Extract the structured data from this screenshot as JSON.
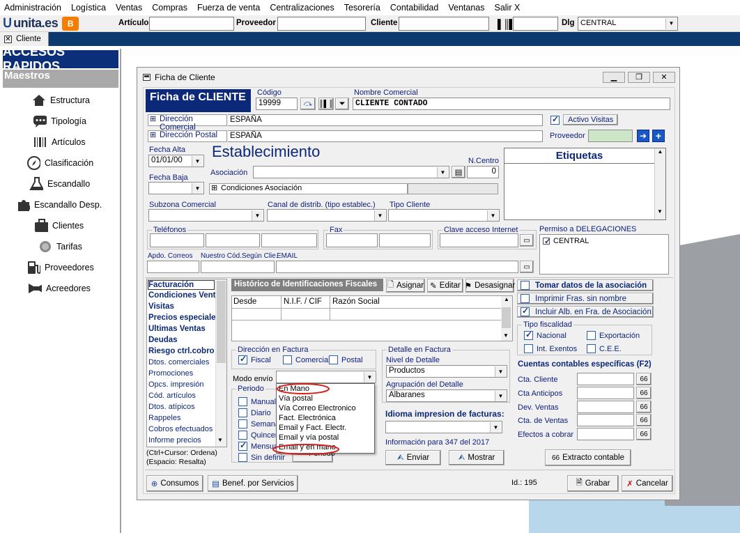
{
  "menu": [
    "Administración",
    "Logística",
    "Ventas",
    "Compras",
    "Fuerza de venta",
    "Centralizaciones",
    "Tesorería",
    "Contabilidad",
    "Ventanas",
    "Salir X"
  ],
  "toolbar": {
    "logo": "unita.es",
    "articulo_label": "Artículo",
    "proveedor_label": "Proveedor",
    "cliente_label": "Cliente",
    "dlg_label": "Dlg",
    "dlg_value": "CENTRAL"
  },
  "tab": {
    "label": "Cliente"
  },
  "left": {
    "header": "ACCESOS RAPIDOS",
    "section": "Maestros",
    "items": [
      {
        "label": "Estructura",
        "icon": "house-icon"
      },
      {
        "label": "Tipología",
        "icon": "speech-bubble-icon"
      },
      {
        "label": "Artículos",
        "icon": "barcode-icon"
      },
      {
        "label": "Clasificación",
        "icon": "compass-icon"
      },
      {
        "label": "Escandallo",
        "icon": "flask-icon"
      },
      {
        "label": "Escandallo Desp.",
        "icon": "puzzle-icon"
      },
      {
        "label": "Clientes",
        "icon": "briefcase-icon"
      },
      {
        "label": "Tarifas",
        "icon": "tag-icon"
      },
      {
        "label": "Proveedores",
        "icon": "fuel-icon"
      },
      {
        "label": "Acreedores",
        "icon": "bowtie-icon"
      }
    ]
  },
  "window": {
    "title": "Ficha de Cliente"
  },
  "form": {
    "header": "Ficha de CLIENTE",
    "codigo_label": "Código",
    "codigo": "19999",
    "nombre_label": "Nombre Comercial",
    "nombre": "CLIENTE CONTADO",
    "dir_comercial": "Dirección Comercial",
    "dir_comercial_val": "ESPAÑA",
    "dir_postal": "Dirección Postal",
    "dir_postal_val": "ESPAÑA",
    "activo_visitas": "Activo Visitas",
    "proveedor": "Proveedor",
    "fecha_alta_label": "Fecha Alta",
    "fecha_alta": "01/01/00",
    "fecha_baja_label": "Fecha Baja",
    "establecimiento": "Establecimiento",
    "asociacion_label": "Asociación",
    "ncentro_label": "N.Centro",
    "ncentro": "0",
    "condiciones": "Condiciones Asociación",
    "etiquetas": "Etiquetas",
    "subzona": "Subzona Comercial",
    "canal": "Canal de distrib. (tipo establec.)",
    "tipo_cliente": "Tipo Cliente",
    "telefonos": "Teléfonos",
    "fax": "Fax",
    "clave": "Clave acceso Internet",
    "permiso": "Permiso a DELEGACIONES",
    "central": "CENTRAL",
    "apdo": "Apdo. Correos",
    "nuestro": "Nuestro Cód.Según Clie.",
    "email": "EMAIL"
  },
  "nav": [
    "Facturación",
    "Condiciones Venta",
    "Visitas",
    "Precios especiales",
    "Ultimas Ventas",
    "Deudas",
    "Riesgo ctrl.cobro",
    "Dtos. comerciales",
    "Promociones",
    "Opcs. impresión",
    "Cód. artículos",
    "Dtos. atípicos",
    "Rappeles",
    "Cobros efectuados",
    "Informe precios"
  ],
  "nav_hint": [
    "(Ctrl+Cursor: Ordena)",
    "(Espacio: Resalta)"
  ],
  "historico": {
    "title": "Histórico de Identificaciones Fiscales",
    "asignar": "Asignar",
    "editar": "Editar",
    "desasignar": "Desasignar",
    "cols": [
      "Desde",
      "N.I.F. / CIF",
      "Razón Social"
    ]
  },
  "dir_factura": {
    "title": "Dirección en Factura",
    "fiscal": "Fiscal",
    "comercial": "Comercial",
    "postal": "Postal"
  },
  "modo_envio": "Modo envío",
  "periodo": {
    "title": "Periodo",
    "items": [
      "Manual",
      "Diario",
      "Semanal",
      "Quincenal",
      "Mensual",
      "Sin definir"
    ],
    "extra": "Periodo"
  },
  "popup": [
    "En Mano",
    "Vía postal",
    "Vía Correo Electronico",
    "Fact. Electrónica",
    "Email y Fact. Electr.",
    "Email y vía postal",
    "Email y en mano"
  ],
  "detalle": {
    "title": "Detalle en Factura",
    "nivel": "Nivel de Detalle",
    "nivel_val": "Productos",
    "agrup": "Agrupación del Detalle",
    "agrup_val": "Albaranes"
  },
  "idioma": "Idioma impresion de facturas:",
  "info347": "Información para 347 del 2017",
  "enviar": "Enviar",
  "mostrar": "Mostrar",
  "right": {
    "tomar": "Tomar datos de la asociación",
    "imprimir": "Imprimir Fras. sin nombre",
    "incluir": "Incluir Alb. en Fra. de Asociación",
    "tipo_fisc": "Tipo fiscalidad",
    "nacional": "Nacional",
    "exportacion": "Exportación",
    "exentos": "Int. Exentos",
    "cee": "C.E.E.",
    "cuentas": "Cuentas contables específicas (F2)",
    "ctas": [
      "Cta. Cliente",
      "Cta Anticipos",
      "Dev. Ventas",
      "Cta. de Ventas",
      "Efectos a cobrar"
    ],
    "extracto": "Extracto contable"
  },
  "footer": {
    "consumos": "Consumos",
    "benef": "Benef. por Servicios",
    "id": "Id.: 195",
    "grabar": "Grabar",
    "cancelar": "Cancelar"
  }
}
